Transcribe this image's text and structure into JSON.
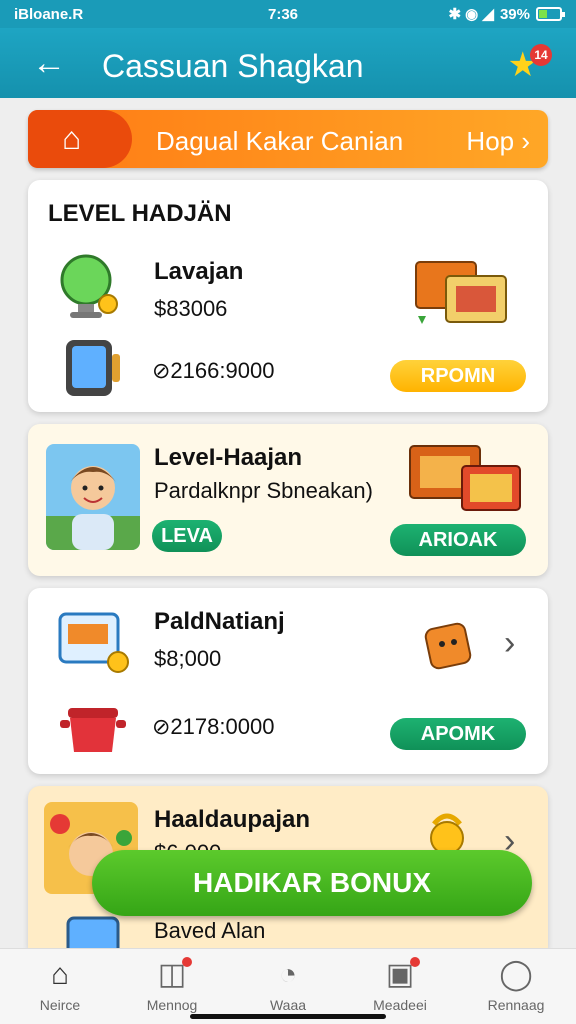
{
  "status_bar": {
    "left": "iBloane.R",
    "time": "7:36",
    "icons": "✱ ◉ ◢",
    "battery_text": "39%",
    "battery_level": 0.39
  },
  "app_bar": {
    "back_icon": "arrow-left",
    "title": "Cassuan Shagkan",
    "trophy_badge": "14"
  },
  "promo": {
    "text": "Dagual Kakar Canian",
    "more": "Hop ›"
  },
  "cards": {
    "c1": {
      "header": "LEVEL HADJÄN",
      "item1_title": "Lavajan",
      "item1_price": "$83006",
      "item2_value": "⊘2166:9000",
      "button": "RPOMN"
    },
    "c2": {
      "title": "LeveI-Haajan",
      "subtitle": "Pardalknpr Sbneakan)",
      "tag": "LEVA",
      "button": "ARIOAK"
    },
    "c3": {
      "title": "PaldNatianj",
      "price": "$8;000",
      "value": "⊘2178:0000",
      "button": "APOMK"
    },
    "c4": {
      "title": "Haaldaupajan",
      "price": "$6.000",
      "second_title": "Baved Alan"
    }
  },
  "bonus_button": "HADIKAR BONUX",
  "bottom_nav": [
    {
      "label": "Neirce",
      "icon": "home-icon"
    },
    {
      "label": "Mennog",
      "icon": "gift-icon"
    },
    {
      "label": "Waaa",
      "icon": "wheel-icon"
    },
    {
      "label": "Meadeei",
      "icon": "inbox-icon"
    },
    {
      "label": "Rennaag",
      "icon": "profile-icon"
    }
  ],
  "colors": {
    "app_bar": "#1a9bb8",
    "promo": "#ff8c1a",
    "green_button": "#1aa566",
    "yellow_button": "#ffc21a",
    "bonus": "#4bb823"
  }
}
